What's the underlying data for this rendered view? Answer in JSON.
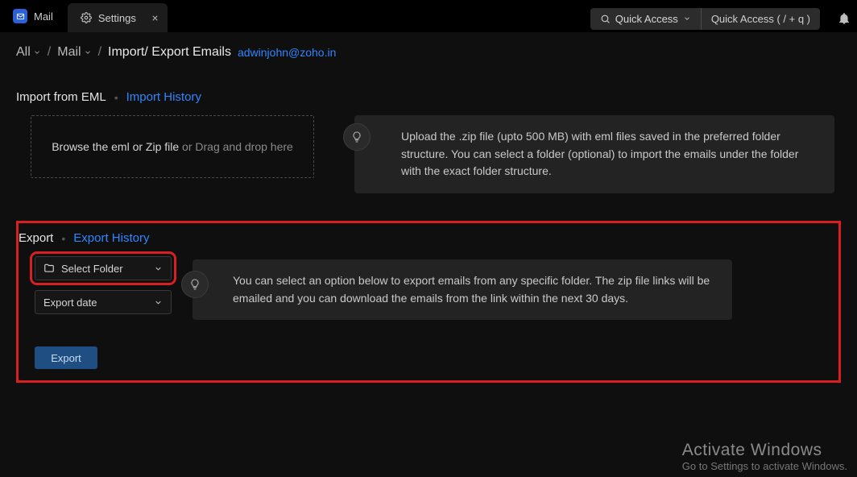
{
  "tabs": {
    "mail_label": "Mail",
    "settings_label": "Settings"
  },
  "quick": {
    "left_label": "Quick Access",
    "right_label": "Quick Access  ( / + q )"
  },
  "breadcrumb": {
    "all": "All",
    "mail": "Mail",
    "title": "Import/ Export Emails",
    "email": "adwinjohn@zoho.in"
  },
  "import": {
    "head_label": "Import from EML",
    "history_label": "Import History",
    "drop_strong": "Browse the eml or Zip file",
    "drop_rest": " or Drag and drop here",
    "tip": "Upload the .zip file (upto 500 MB) with eml files saved in the preferred folder structure. You can select a folder (optional) to import the emails under the folder with the exact folder structure."
  },
  "export": {
    "head_label": "Export",
    "history_label": "Export History",
    "select_folder_label": "Select Folder",
    "export_date_label": "Export date",
    "button_label": "Export",
    "tip": "You can select an option below to export emails from any specific folder. The zip file links will be emailed and you can download the emails from the link within the next 30 days."
  },
  "watermark": {
    "title": "Activate Windows",
    "subtitle": "Go to Settings to activate Windows."
  }
}
